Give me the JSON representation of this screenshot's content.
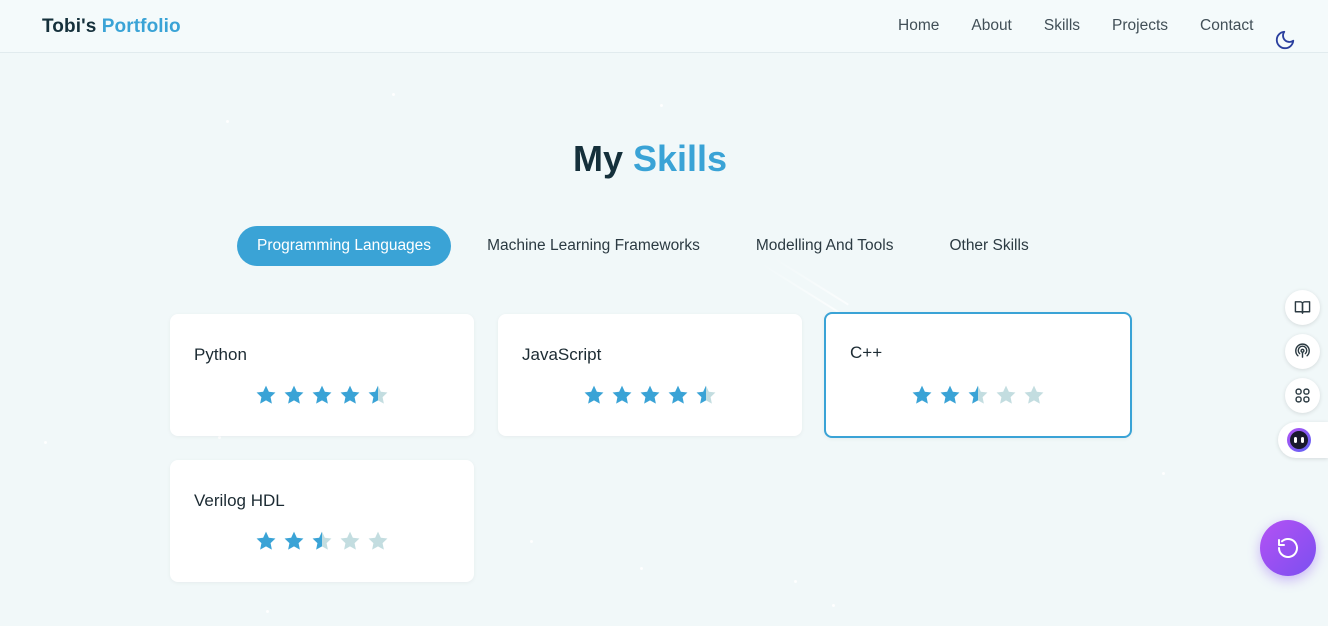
{
  "header": {
    "logo_first": "Tobi's",
    "logo_second": "Portfolio",
    "nav": [
      "Home",
      "About",
      "Skills",
      "Projects",
      "Contact"
    ],
    "theme_toggle_icon": "moon-icon"
  },
  "section": {
    "title_first": "My",
    "title_second": "Skills"
  },
  "tabs": {
    "active": "Programming Languages",
    "items": [
      "Programming Languages",
      "Machine Learning Frameworks",
      "Modelling And Tools",
      "Other Skills"
    ]
  },
  "skills": [
    {
      "name": "Python",
      "rating": 4.5,
      "max": 5
    },
    {
      "name": "JavaScript",
      "rating": 4.5,
      "max": 5
    },
    {
      "name": "C++",
      "rating": 2.5,
      "max": 5
    },
    {
      "name": "Verilog HDL",
      "rating": 2.5,
      "max": 5
    }
  ],
  "sidebar_icons": [
    "book-icon",
    "podcast-icon",
    "apps-icon",
    "assistant-face-icon"
  ],
  "fab_icon": "refresh-icon",
  "colors": {
    "accent": "#3aa3d6",
    "star_filled": "#3aa3d6",
    "star_empty": "#c3dde0",
    "fab_gradient_start": "#b452f4",
    "fab_gradient_end": "#7b4ff0"
  }
}
